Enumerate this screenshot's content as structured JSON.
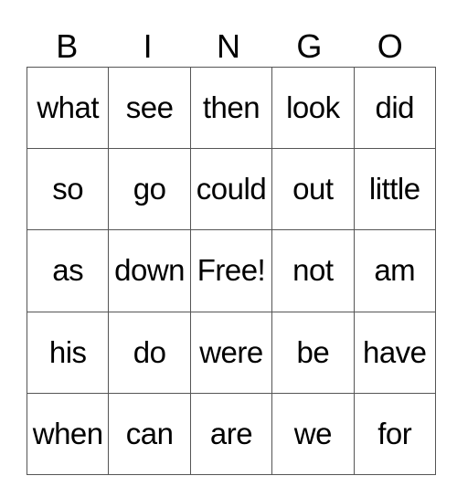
{
  "card": {
    "header": [
      "B",
      "I",
      "N",
      "G",
      "O"
    ],
    "rows": [
      [
        "what",
        "see",
        "then",
        "look",
        "did"
      ],
      [
        "so",
        "go",
        "could",
        "out",
        "little"
      ],
      [
        "as",
        "down",
        "Free!",
        "not",
        "am"
      ],
      [
        "his",
        "do",
        "were",
        "be",
        "have"
      ],
      [
        "when",
        "can",
        "are",
        "we",
        "for"
      ]
    ]
  }
}
